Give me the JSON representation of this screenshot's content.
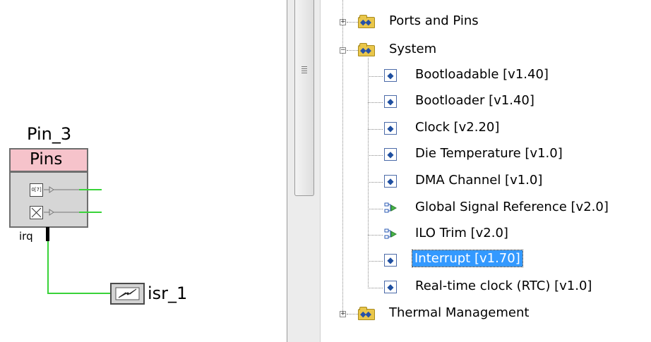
{
  "schematic": {
    "component_name": "Pin_3",
    "component_type": "Pins",
    "pin_symbol_text": "0[7]",
    "irq_label": "irq",
    "isr_name": "isr_1"
  },
  "tree": {
    "categories": [
      {
        "label": "Ports and Pins",
        "expanded": false,
        "icon": "component-folder-icon"
      },
      {
        "label": "System",
        "expanded": true,
        "icon": "component-folder-icon"
      },
      {
        "label": "Thermal Management",
        "expanded": false,
        "icon": "component-folder-icon"
      }
    ],
    "system_items": [
      {
        "label": "Bootloadable [v1.40]",
        "icon": "component-icon"
      },
      {
        "label": "Bootloader [v1.40]",
        "icon": "component-icon"
      },
      {
        "label": "Clock [v2.20]",
        "icon": "component-icon"
      },
      {
        "label": "Die Temperature [v1.0]",
        "icon": "component-icon"
      },
      {
        "label": "DMA Channel [v1.0]",
        "icon": "component-icon"
      },
      {
        "label": "Global Signal Reference [v2.0]",
        "icon": "signal-component-icon"
      },
      {
        "label": "ILO Trim [v2.0]",
        "icon": "signal-component-icon"
      },
      {
        "label": "Interrupt [v1.70]",
        "icon": "component-icon",
        "selected": true
      },
      {
        "label": "Real-time clock (RTC) [v1.0]",
        "icon": "component-icon"
      }
    ]
  },
  "colors": {
    "wire": "#39d339",
    "pins_header": "#f6c3cb",
    "selection": "#3399ff",
    "folder": "#e9c64a"
  }
}
